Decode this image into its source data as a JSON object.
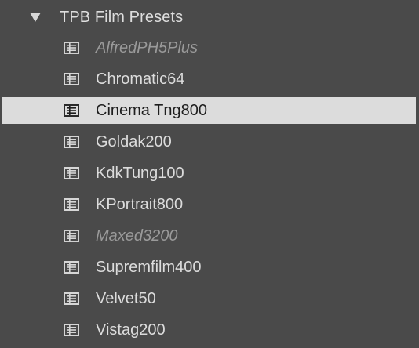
{
  "group": {
    "label": "TPB Film Presets",
    "expanded": true,
    "icon": "disclosure-triangle-down-icon"
  },
  "presets": [
    {
      "label": "AlfredPH5Plus",
      "state": "disabled",
      "icon": "preset-icon"
    },
    {
      "label": "Chromatic64",
      "state": "normal",
      "icon": "preset-icon"
    },
    {
      "label": "Cinema Tng800",
      "state": "selected",
      "icon": "preset-icon"
    },
    {
      "label": "Goldak200",
      "state": "normal",
      "icon": "preset-icon"
    },
    {
      "label": "KdkTung100",
      "state": "normal",
      "icon": "preset-icon"
    },
    {
      "label": "KPortrait800",
      "state": "normal",
      "icon": "preset-icon"
    },
    {
      "label": "Maxed3200",
      "state": "disabled",
      "icon": "preset-icon"
    },
    {
      "label": "Supremfilm400",
      "state": "normal",
      "icon": "preset-icon"
    },
    {
      "label": "Velvet50",
      "state": "normal",
      "icon": "preset-icon"
    },
    {
      "label": "Vistag200",
      "state": "normal",
      "icon": "preset-icon"
    }
  ],
  "colors": {
    "panel_background": "#4a4a4a",
    "text": "#dcdcdc",
    "disabled_text": "#9a9a9a",
    "selection_background": "#dcdcdc",
    "selection_text": "#1e1e1e"
  }
}
